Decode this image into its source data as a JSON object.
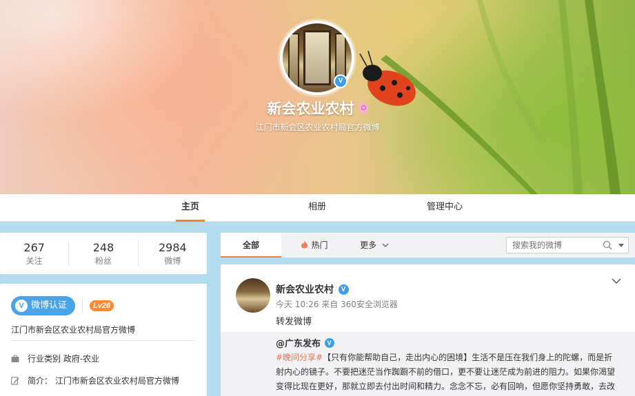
{
  "profile": {
    "name": "新会农业农村",
    "description": "江门市新会区农业农村局官方微博"
  },
  "nav": {
    "tabs": [
      {
        "label": "主页",
        "active": true
      },
      {
        "label": "相册",
        "active": false
      },
      {
        "label": "管理中心",
        "active": false
      }
    ]
  },
  "stats": [
    {
      "value": "267",
      "label": "关注"
    },
    {
      "value": "248",
      "label": "粉丝"
    },
    {
      "value": "2984",
      "label": "微博"
    }
  ],
  "info": {
    "verify_label": "微博认证",
    "level": "Lv26",
    "description": "江门市新会区农业农村局官方微博",
    "industry_label": "行业类别",
    "industry_value": "政府-农业",
    "intro_label": "简介：",
    "intro_value": "江门市新会区农业农村局官方微博"
  },
  "feed": {
    "tabs": [
      {
        "label": "全部",
        "active": true
      },
      {
        "label": "热门",
        "active": false
      },
      {
        "label": "更多",
        "active": false
      }
    ],
    "search_placeholder": "搜索我的微博"
  },
  "post": {
    "author": "新会农业农村",
    "meta": "今天 10:26 来自 360安全浏览器",
    "text": "转发微博",
    "repost": {
      "author": "@广东发布",
      "hashtag": "#晚间分享#",
      "text": "【只有你能帮助自己，走出内心的困境】生活不是压在我们身上的陀螺，而是折射内心的镜子。不要把迷茫当作踟蹰不前的借口，更不要让迷茫成为前进的阻力。如果你渴望变得比现在更好，那就立即去付出时间和精力。念念不忘，必有回响，但愿你坚持勇敢，去改"
    }
  },
  "colors": {
    "accent": "#fa7d3c",
    "verify_blue": "#4aa3e8",
    "level_orange": "#ff8a34",
    "hashtag": "#eb7350"
  }
}
